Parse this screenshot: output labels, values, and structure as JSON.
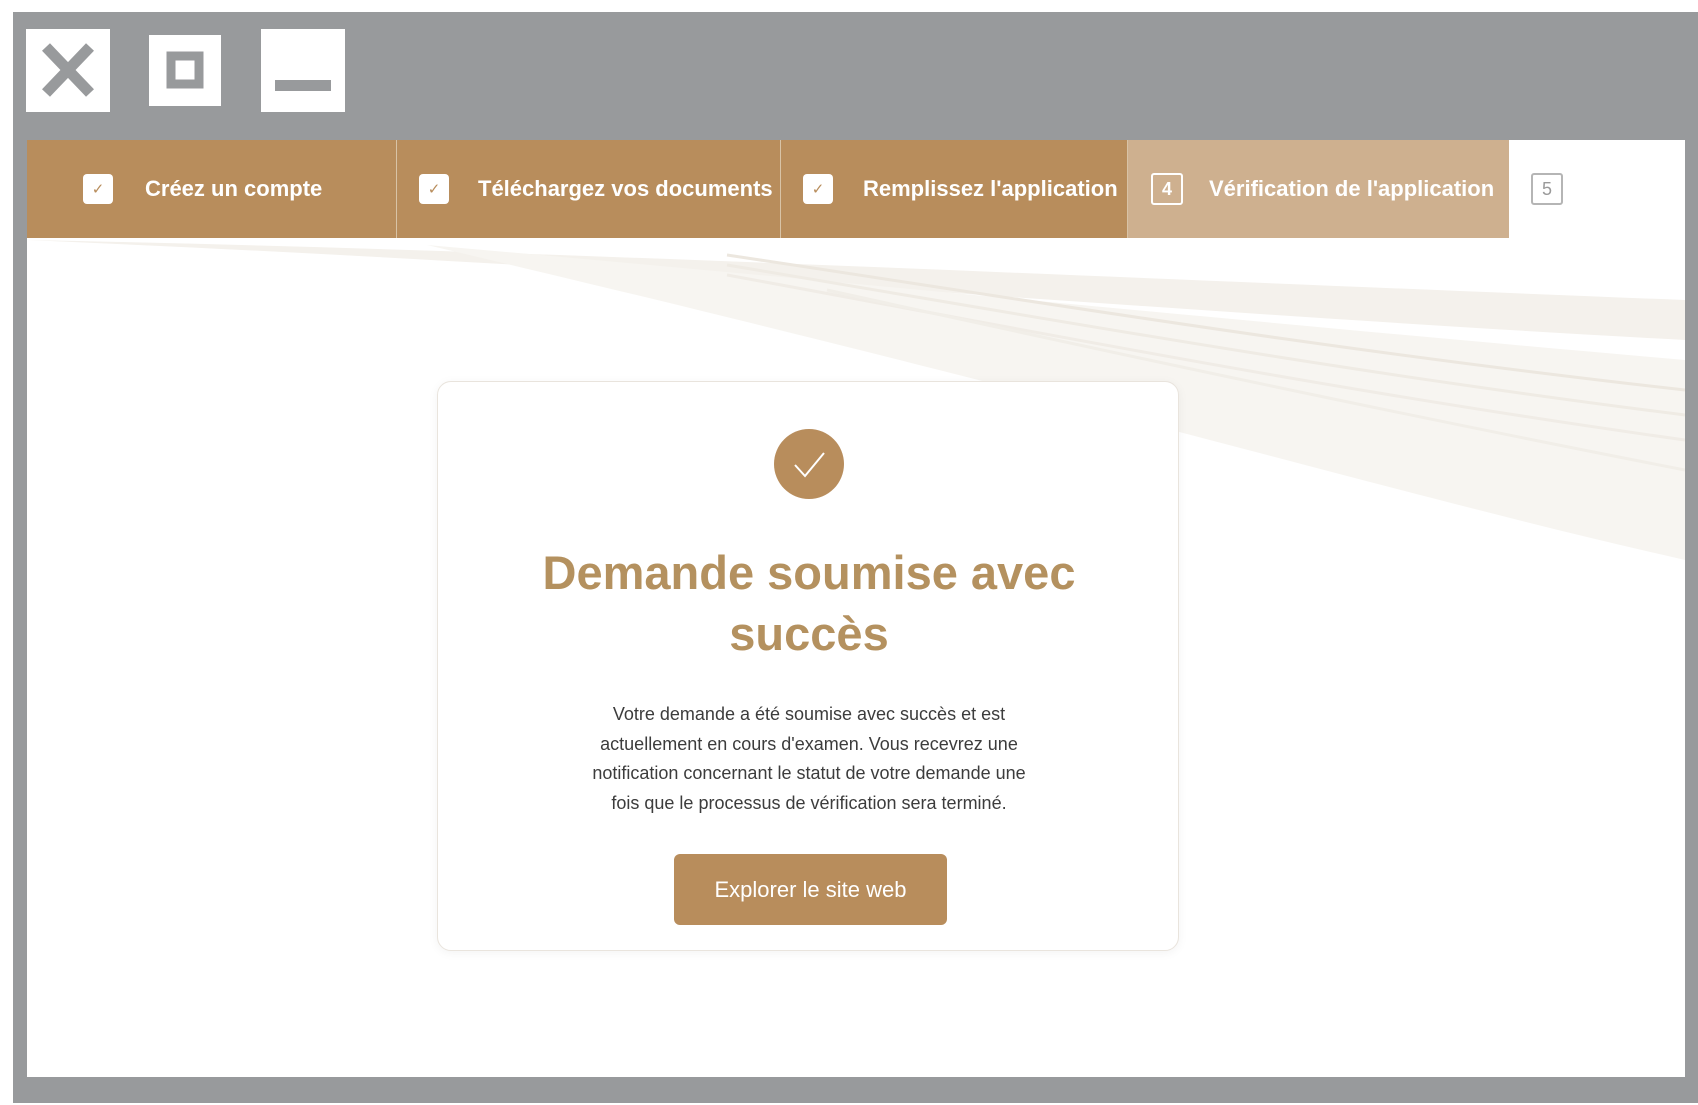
{
  "window_controls": {
    "close": "close-icon",
    "maximize": "maximize-icon",
    "minimize": "minimize-icon"
  },
  "stepper": {
    "steps": [
      {
        "label": "Créez un compte",
        "state": "done"
      },
      {
        "label": "Téléchargez vos documents",
        "state": "done"
      },
      {
        "label": "Remplissez l'application",
        "state": "done"
      },
      {
        "label": "Vérification de l'application",
        "number": "4",
        "state": "current"
      },
      {
        "label": "",
        "number": "5",
        "state": "todo"
      }
    ]
  },
  "card": {
    "icon": "check-circle-icon",
    "title_line1": "Demande soumise avec",
    "title_line2": "succès",
    "message_lines": [
      "Votre demande a été soumise avec succès et est",
      "actuellement en cours d'examen. Vous recevrez une",
      "notification concernant le statut de votre demande une",
      "fois que le processus de vérification sera terminé."
    ],
    "button_label": "Explorer le site web"
  },
  "colors": {
    "accent": "#b88d5c",
    "current_step": "#ceb08f",
    "title": "#b4915f",
    "frame": "#989a9c"
  }
}
